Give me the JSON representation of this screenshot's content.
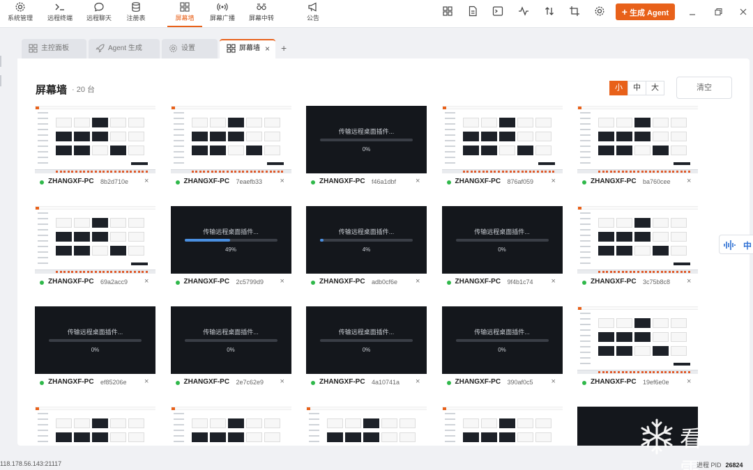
{
  "nav": {
    "items": [
      {
        "label": "系统管理",
        "icon": "gear-icon"
      },
      {
        "label": "远程终端",
        "icon": "terminal-icon"
      },
      {
        "label": "远程聊天",
        "icon": "chat-icon"
      },
      {
        "label": "注册表",
        "icon": "database-icon"
      },
      {
        "label": "屏幕墙",
        "icon": "grid-icon",
        "active": true
      },
      {
        "label": "屏幕广播",
        "icon": "broadcast-icon"
      },
      {
        "label": "屏幕中转",
        "icon": "relay-icon"
      },
      {
        "label": "公告",
        "icon": "megaphone-icon"
      }
    ]
  },
  "toolbar": {
    "icons": [
      "dashboard-icon",
      "document-icon",
      "terminal-window-icon",
      "activity-icon",
      "transfer-icon",
      "crop-icon",
      "settings-icon"
    ],
    "generate_label": "生成 Agent"
  },
  "tabs": [
    {
      "label": "主控面板",
      "icon": "dashboard-icon"
    },
    {
      "label": "Agent 生成",
      "icon": "rocket-icon"
    },
    {
      "label": "设置",
      "icon": "gear-icon"
    },
    {
      "label": "屏幕墙",
      "icon": "grid-icon",
      "active": true,
      "close": "×"
    }
  ],
  "tab_add": "+",
  "wall": {
    "title": "屏幕墙",
    "count": "· 20 台",
    "sizes": [
      "小",
      "中",
      "大"
    ],
    "selected_size": "小",
    "clear_label": "清空",
    "loading_text": "传输远程桌面插件...",
    "close_symbol": "×",
    "accent_color": "#e8611a",
    "online_color": "#2fb84a"
  },
  "devices": [
    {
      "host": "ZHANGXF-PC",
      "id": "8b2d710e",
      "state": "screen"
    },
    {
      "host": "ZHANGXF-PC",
      "id": "7eaefb33",
      "state": "screen"
    },
    {
      "host": "ZHANGXF-PC",
      "id": "f46a1dbf",
      "state": "loading",
      "progress": 0,
      "progress_label": "0%"
    },
    {
      "host": "ZHANGXF-PC",
      "id": "876af059",
      "state": "screen"
    },
    {
      "host": "ZHANGXF-PC",
      "id": "ba760cee",
      "state": "screen"
    },
    {
      "host": "ZHANGXF-PC",
      "id": "69a2acc9",
      "state": "screen"
    },
    {
      "host": "ZHANGXF-PC",
      "id": "2c5799d9",
      "state": "loading",
      "progress": 49,
      "progress_label": "49%"
    },
    {
      "host": "ZHANGXF-PC",
      "id": "adb0cf6e",
      "state": "loading",
      "progress": 4,
      "progress_label": "4%"
    },
    {
      "host": "ZHANGXF-PC",
      "id": "9f4b1c74",
      "state": "loading",
      "progress": 0,
      "progress_label": "0%"
    },
    {
      "host": "ZHANGXF-PC",
      "id": "3c75b8c8",
      "state": "screen"
    },
    {
      "host": "ZHANGXF-PC",
      "id": "ef85206e",
      "state": "loading",
      "progress": 0,
      "progress_label": "0%"
    },
    {
      "host": "ZHANGXF-PC",
      "id": "2e7c62e9",
      "state": "loading",
      "progress": 0,
      "progress_label": "0%"
    },
    {
      "host": "ZHANGXF-PC",
      "id": "4a10741a",
      "state": "loading",
      "progress": 0,
      "progress_label": "0%"
    },
    {
      "host": "ZHANGXF-PC",
      "id": "390af0c5",
      "state": "loading",
      "progress": 0,
      "progress_label": "0%"
    },
    {
      "host": "ZHANGXF-PC",
      "id": "19ef6e0e",
      "state": "screen"
    },
    {
      "state": "screen"
    },
    {
      "state": "screen"
    },
    {
      "state": "screen"
    },
    {
      "state": "screen"
    },
    {
      "state": "dark"
    }
  ],
  "float_tab": {
    "icon": "voice-wave-icon",
    "label": "中"
  },
  "watermark": {
    "text": "看雪",
    "icon": "snowflake-icon"
  },
  "status": {
    "address": "118.178.56.143:21117",
    "pid_label": "进程 PID",
    "pid": "26824"
  }
}
